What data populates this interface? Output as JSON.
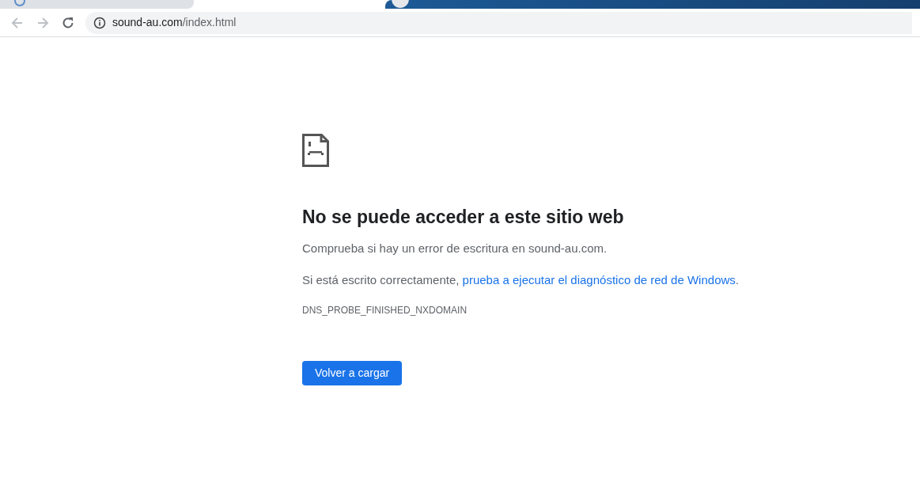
{
  "address_bar": {
    "host": "sound-au.com",
    "path": "/index.html"
  },
  "nav": {
    "back_disabled": true,
    "forward_disabled": true
  },
  "error": {
    "heading": "No se puede acceder a este sitio web",
    "message": "Comprueba si hay un error de escritura en sound-au.com.",
    "suggestion": {
      "prefix": "Si está escrito correctamente, ",
      "link": "prueba a ejecutar el diagnóstico de red de Windows",
      "suffix": "."
    },
    "code": "DNS_PROBE_FINISHED_NXDOMAIN",
    "button": "Volver a cargar"
  }
}
